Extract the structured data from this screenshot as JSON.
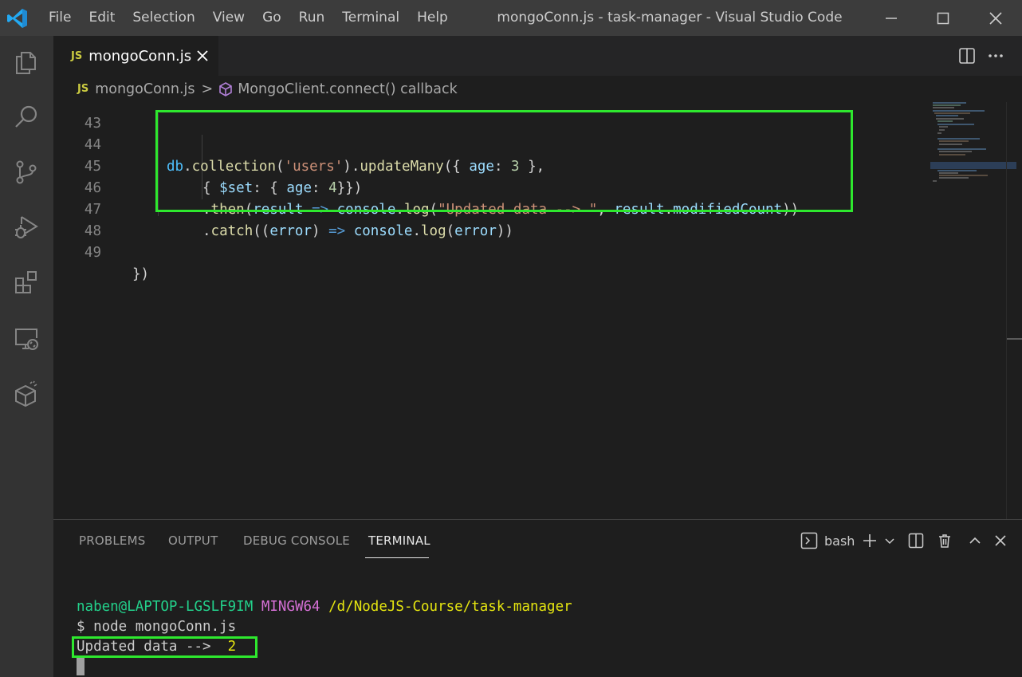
{
  "window": {
    "title": "mongoConn.js - task-manager - Visual Studio Code"
  },
  "menu": [
    "File",
    "Edit",
    "Selection",
    "View",
    "Go",
    "Run",
    "Terminal",
    "Help"
  ],
  "tab": {
    "badge": "JS",
    "label": "mongoConn.js"
  },
  "breadcrumb": {
    "badge": "JS",
    "file": "mongoConn.js",
    "separator": ">",
    "symbol": "MongoClient.connect() callback"
  },
  "editor": {
    "lines": [
      {
        "number": "43"
      },
      {
        "number": "44",
        "tokens": [
          "db",
          ".",
          "collection",
          "(",
          "'users'",
          ").",
          "updateMany",
          "(",
          "{ ",
          "age",
          ": ",
          "3",
          " },"
        ]
      },
      {
        "number": "45",
        "tokens": [
          "{ ",
          "$set",
          ": { ",
          "age",
          ": ",
          "4",
          "}})"
        ]
      },
      {
        "number": "46",
        "tokens": [
          ".",
          "then",
          "(",
          "result",
          " => ",
          "console",
          ".",
          "log",
          "(",
          "\"Updated data --> \"",
          ", ",
          "result",
          ".",
          "modifiedCount",
          "))"
        ]
      },
      {
        "number": "47",
        "tokens": [
          ".",
          "catch",
          "((",
          "error",
          ") ",
          "=>",
          " ",
          "console",
          ".",
          "log",
          "(",
          "error",
          "))"
        ]
      },
      {
        "number": "48"
      },
      {
        "number": "49",
        "tokens": [
          "})"
        ]
      }
    ]
  },
  "panel": {
    "tabs": [
      "PROBLEMS",
      "OUTPUT",
      "DEBUG CONSOLE",
      "TERMINAL"
    ],
    "active_tab": "TERMINAL",
    "shell": "bash"
  },
  "terminal": {
    "user": "naben@LAPTOP-LGSLF9IM",
    "env": "MINGW64",
    "path": "/d/NodeJS-Course/task-manager",
    "command": "$ node mongoConn.js",
    "output_label": "Updated data -->  ",
    "output_count": "2"
  },
  "colors": {
    "highlight_box": "#2ee82e",
    "titlebar": "#3c3c3c",
    "activity_bar": "#333333",
    "editor_bg": "#1e1e1e"
  },
  "icons": [
    "vscode-logo-icon",
    "explorer-icon",
    "search-icon",
    "source-control-icon",
    "run-debug-icon",
    "extensions-icon",
    "remote-explorer-icon",
    "docker-icon"
  ]
}
